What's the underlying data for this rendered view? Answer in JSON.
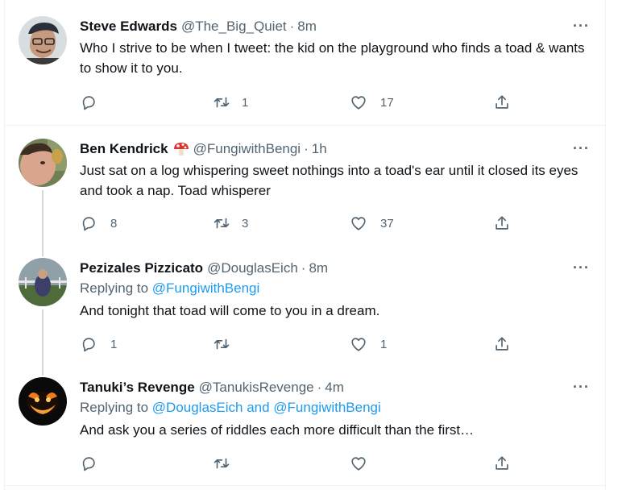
{
  "tweets": [
    {
      "name": "Steve Edwards",
      "handle": "@The_Big_Quiet",
      "time": "8m",
      "more": "···",
      "text": "Who I strive to be when I tweet: the kid on the playground who finds a toad & wants to show it to you.",
      "replies": "",
      "retweets": "1",
      "likes": "17"
    },
    {
      "name": "Ben Kendrick",
      "emoji": "mushroom-icon",
      "handle": "@FungiwithBengi",
      "time": "1h",
      "more": "···",
      "text": "Just sat on a log whispering sweet nothings into a toad's ear until it closed its eyes and took a nap. Toad whisperer",
      "replies": "8",
      "retweets": "3",
      "likes": "37"
    },
    {
      "name": "Pezizales Pizzicato",
      "handle": "@DouglasEich",
      "time": "8m",
      "more": "···",
      "replying_prefix": "Replying to ",
      "replying_to": "@FungiwithBengi",
      "text": "And tonight that toad will come to you in a dream.",
      "replies": "1",
      "retweets": "",
      "likes": "1"
    },
    {
      "name": "Tanuki’s Revenge",
      "handle": "@TanukisRevenge",
      "time": "4m",
      "more": "···",
      "replying_prefix": "Replying to ",
      "replying_to": "@DouglasEich and @FungiwithBengi",
      "text": "And ask you a series of riddles each more difficult than the first…",
      "replies": "",
      "retweets": "",
      "likes": ""
    }
  ],
  "separator": "·",
  "colors": {
    "text": "#0f1419",
    "secondary": "#536471",
    "link": "#1d9bf0",
    "border": "#eff3f4",
    "thread_line": "#cfd9de"
  }
}
